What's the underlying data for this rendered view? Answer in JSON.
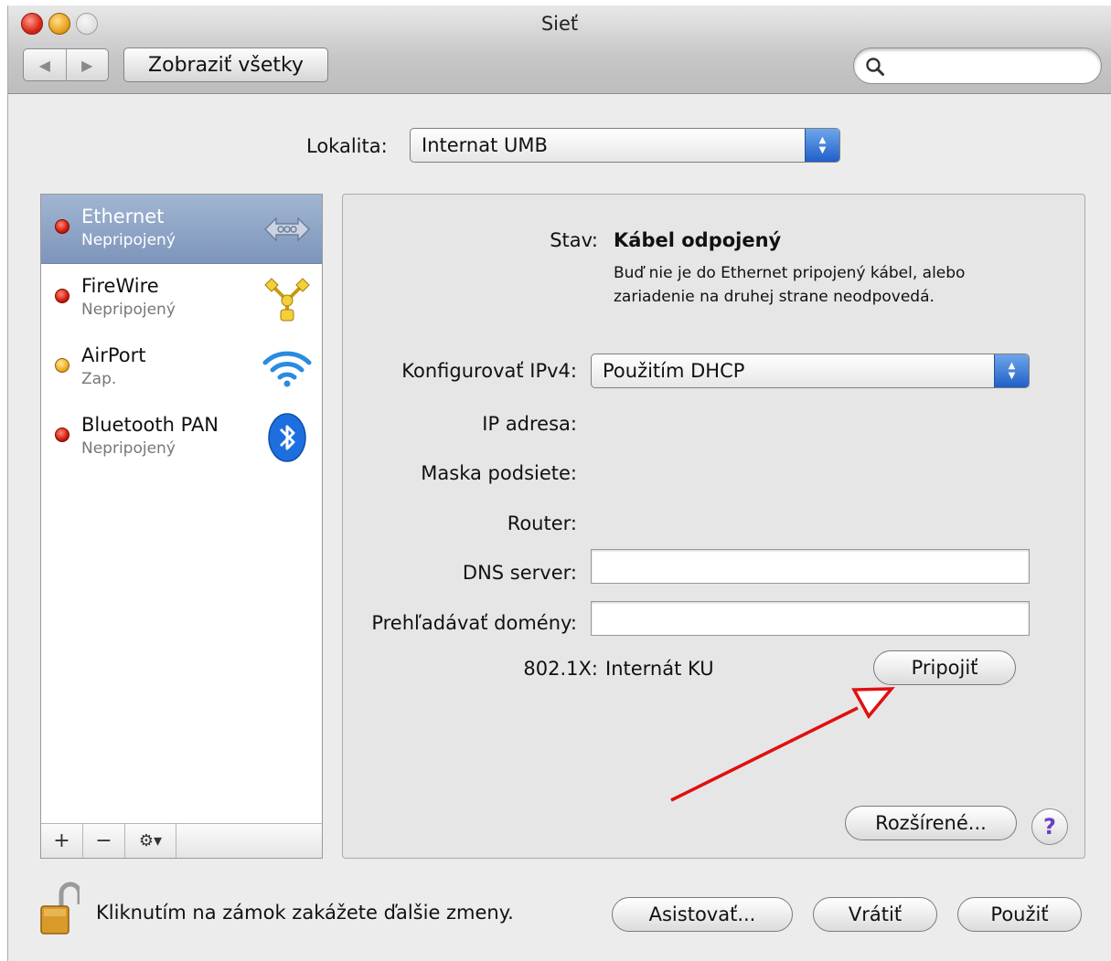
{
  "window": {
    "title": "Sieť"
  },
  "toolbar": {
    "back_icon": "back-arrow-icon",
    "forward_icon": "forward-arrow-icon",
    "show_all_label": "Zobraziť všetky",
    "search_placeholder": "",
    "search_icon": "search-icon"
  },
  "location": {
    "label": "Lokalita:",
    "value": "Internat UMB"
  },
  "services": [
    {
      "name": "Ethernet",
      "status": "Nepripojený",
      "dot": "red",
      "icon": "ethernet-icon",
      "selected": true
    },
    {
      "name": "FireWire",
      "status": "Nepripojený",
      "dot": "red",
      "icon": "firewire-icon",
      "selected": false
    },
    {
      "name": "AirPort",
      "status": "Zap.",
      "dot": "yellow",
      "icon": "wifi-icon",
      "selected": false
    },
    {
      "name": "Bluetooth PAN",
      "status": "Nepripojený",
      "dot": "red",
      "icon": "bluetooth-icon",
      "selected": false
    }
  ],
  "sidebar_controls": {
    "add": "+",
    "remove": "−",
    "gear": "⚙▾"
  },
  "detail": {
    "status_label": "Stav:",
    "status_value": "Kábel odpojený",
    "status_description_1": "Buď nie je do Ethernet pripojený kábel, alebo",
    "status_description_2": "zariadenie na druhej strane neodpovedá.",
    "configure_label": "Konfigurovať IPv4:",
    "configure_value": "Použitím DHCP",
    "ip_label": "IP adresa:",
    "mask_label": "Maska podsiete:",
    "router_label": "Router:",
    "dns_label": "DNS server:",
    "dns_value": "",
    "search_domains_label": "Prehľadávať domény:",
    "search_domains_value": "",
    "dot1x_label": "802.1X:",
    "dot1x_value": "Internát KU",
    "connect_button": "Pripojiť",
    "advanced_button": "Rozšírené...",
    "help_button": "?"
  },
  "footer": {
    "lock_text": "Kliknutím na zámok zakážete ďalšie zmeny.",
    "assist_button": "Asistovať...",
    "revert_button": "Vrátiť",
    "apply_button": "Použiť"
  },
  "colors": {
    "selection": "#8da3c6",
    "status_red": "#d01a0a",
    "status_yellow": "#eeaa1e",
    "annotation_arrow": "#e01010",
    "help_accent": "#6a3fc7"
  }
}
